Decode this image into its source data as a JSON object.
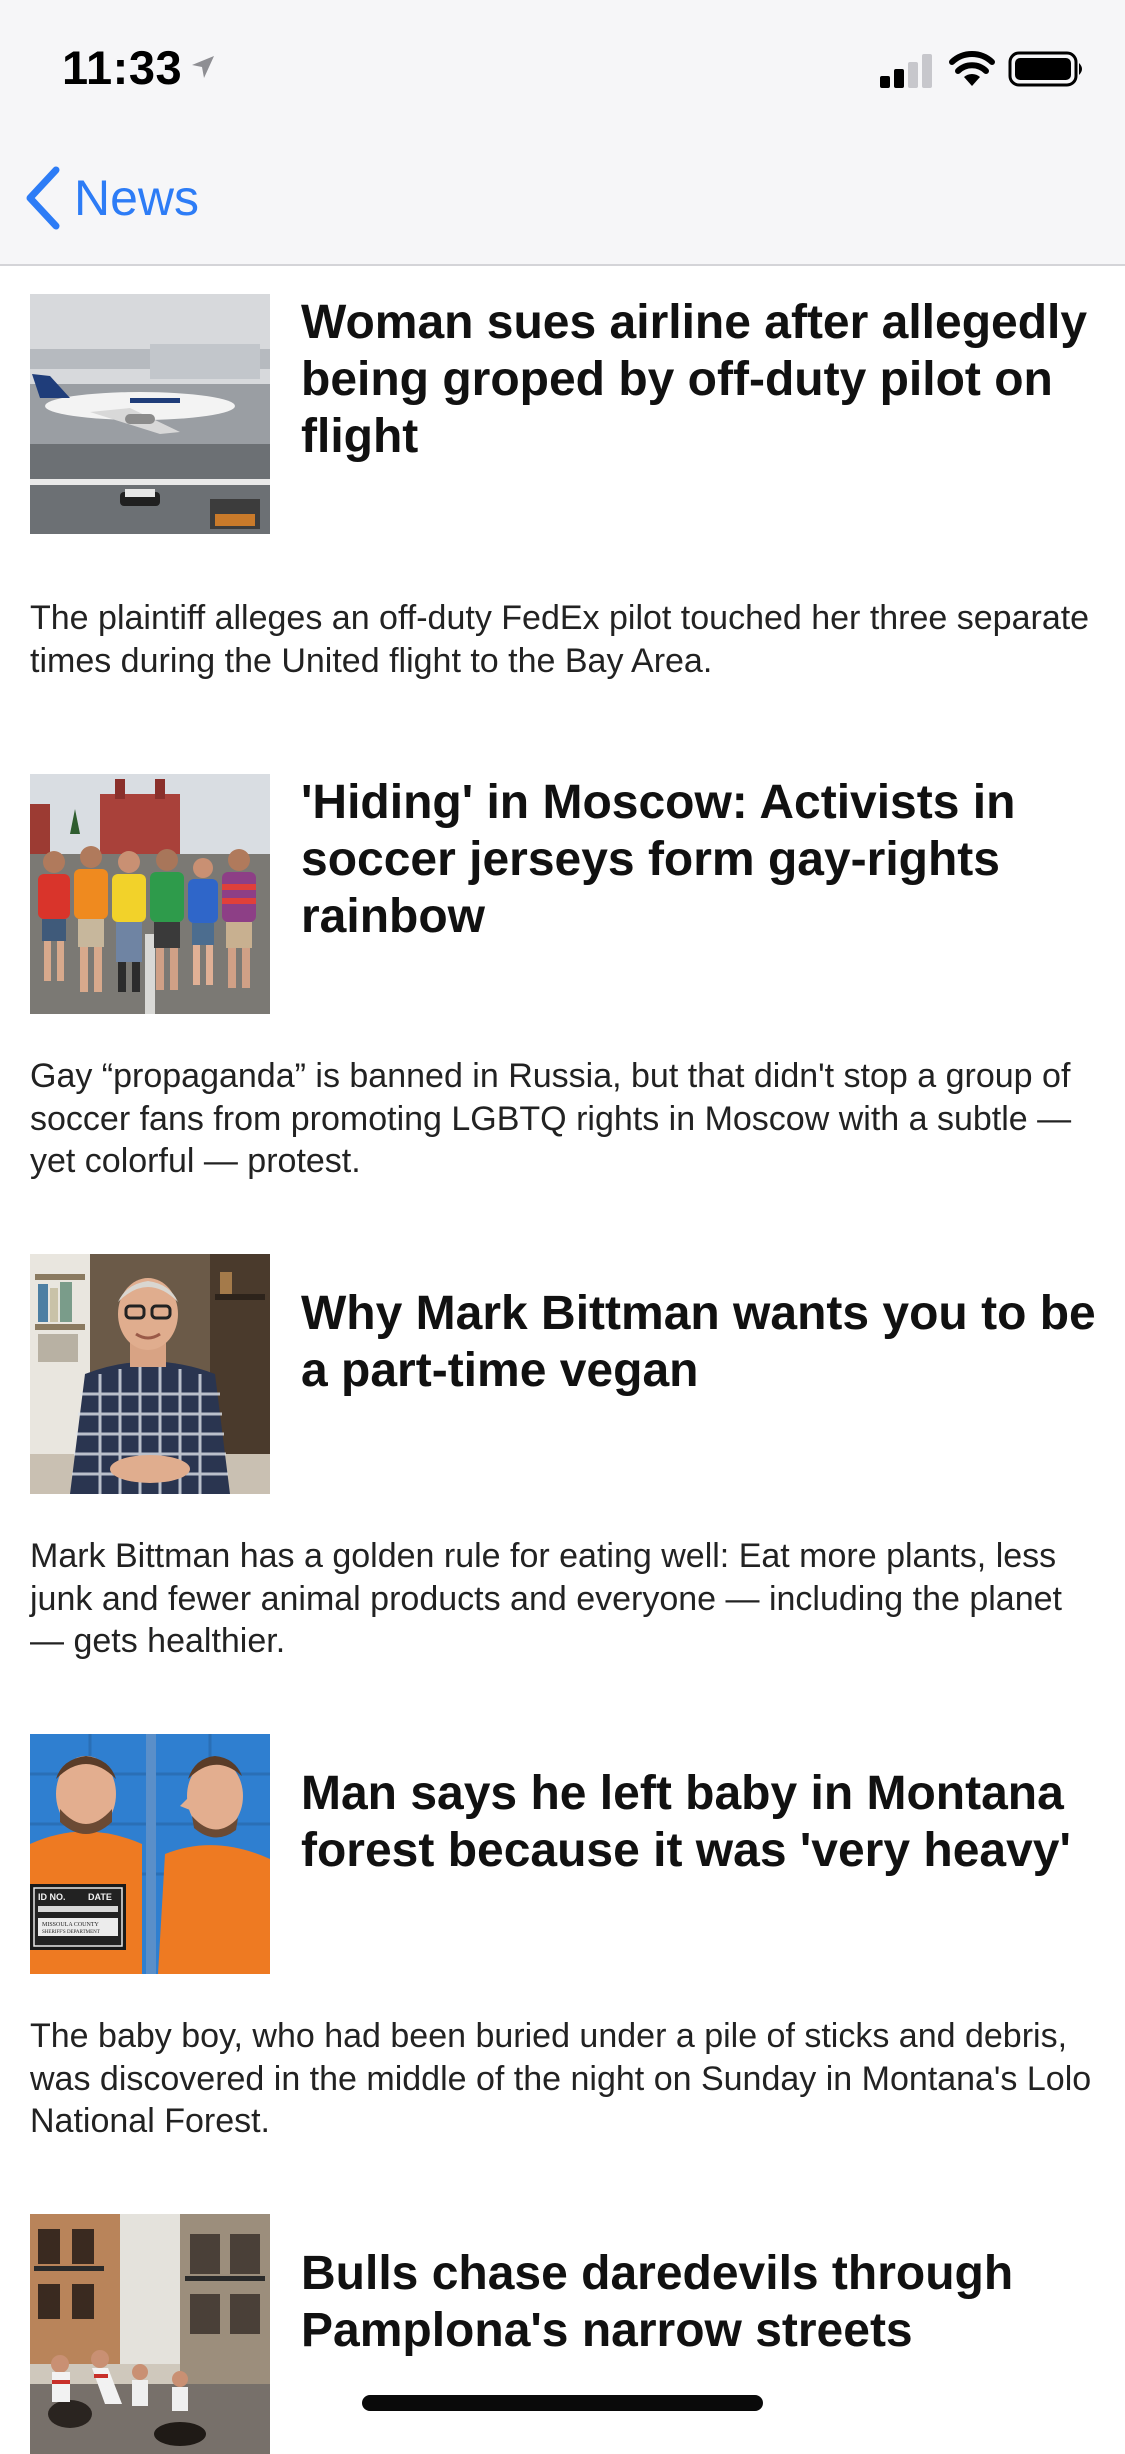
{
  "status_bar": {
    "time": "11:33",
    "location_icon": "location-arrow-icon",
    "signal_icon": "cellular-signal-icon",
    "wifi_icon": "wifi-icon",
    "battery_icon": "battery-icon"
  },
  "nav": {
    "back_label": "News",
    "back_icon": "chevron-left-icon",
    "accent_color": "#2d7cf6"
  },
  "articles": [
    {
      "headline": "Woman sues airline after allegedly being groped by off-duty pilot on flight",
      "summary": "The plaintiff alleges an off-duty FedEx pilot touched her three separate times during the United flight to the Bay Area.",
      "thumbnail": "airplane-photo"
    },
    {
      "headline": "'Hiding' in Moscow: Activists in soccer jerseys form gay-rights rainbow",
      "summary": "Gay “propaganda” is banned in Russia, but that didn't stop a group of soccer fans from promoting LGBTQ rights in Moscow with a subtle — yet colorful — protest.",
      "thumbnail": "activists-photo"
    },
    {
      "headline": "Why Mark Bittman wants you to be a part-time vegan",
      "summary": "Mark Bittman has a golden rule for eating well: Eat more plants, less junk and fewer animal products and everyone — including the planet — gets healthier.",
      "thumbnail": "portrait-photo"
    },
    {
      "headline": "Man says he left baby in Montana forest because it was 'very heavy'",
      "summary": "The baby boy, who had been buried under a pile of sticks and debris, was discovered in the middle of the night on Sunday in Montana's Lolo National Forest.",
      "thumbnail": "mugshot-photo",
      "thumbnail_text": {
        "id_label": "ID NO.",
        "date_label": "DATE",
        "board_line1": "MISSOULA COUNTY",
        "board_line2": "SHERIFF'S DEPARTMENT"
      }
    },
    {
      "headline": "Bulls chase daredevils through Pamplona's narrow streets",
      "summary": "",
      "thumbnail": "street-run-photo"
    }
  ]
}
